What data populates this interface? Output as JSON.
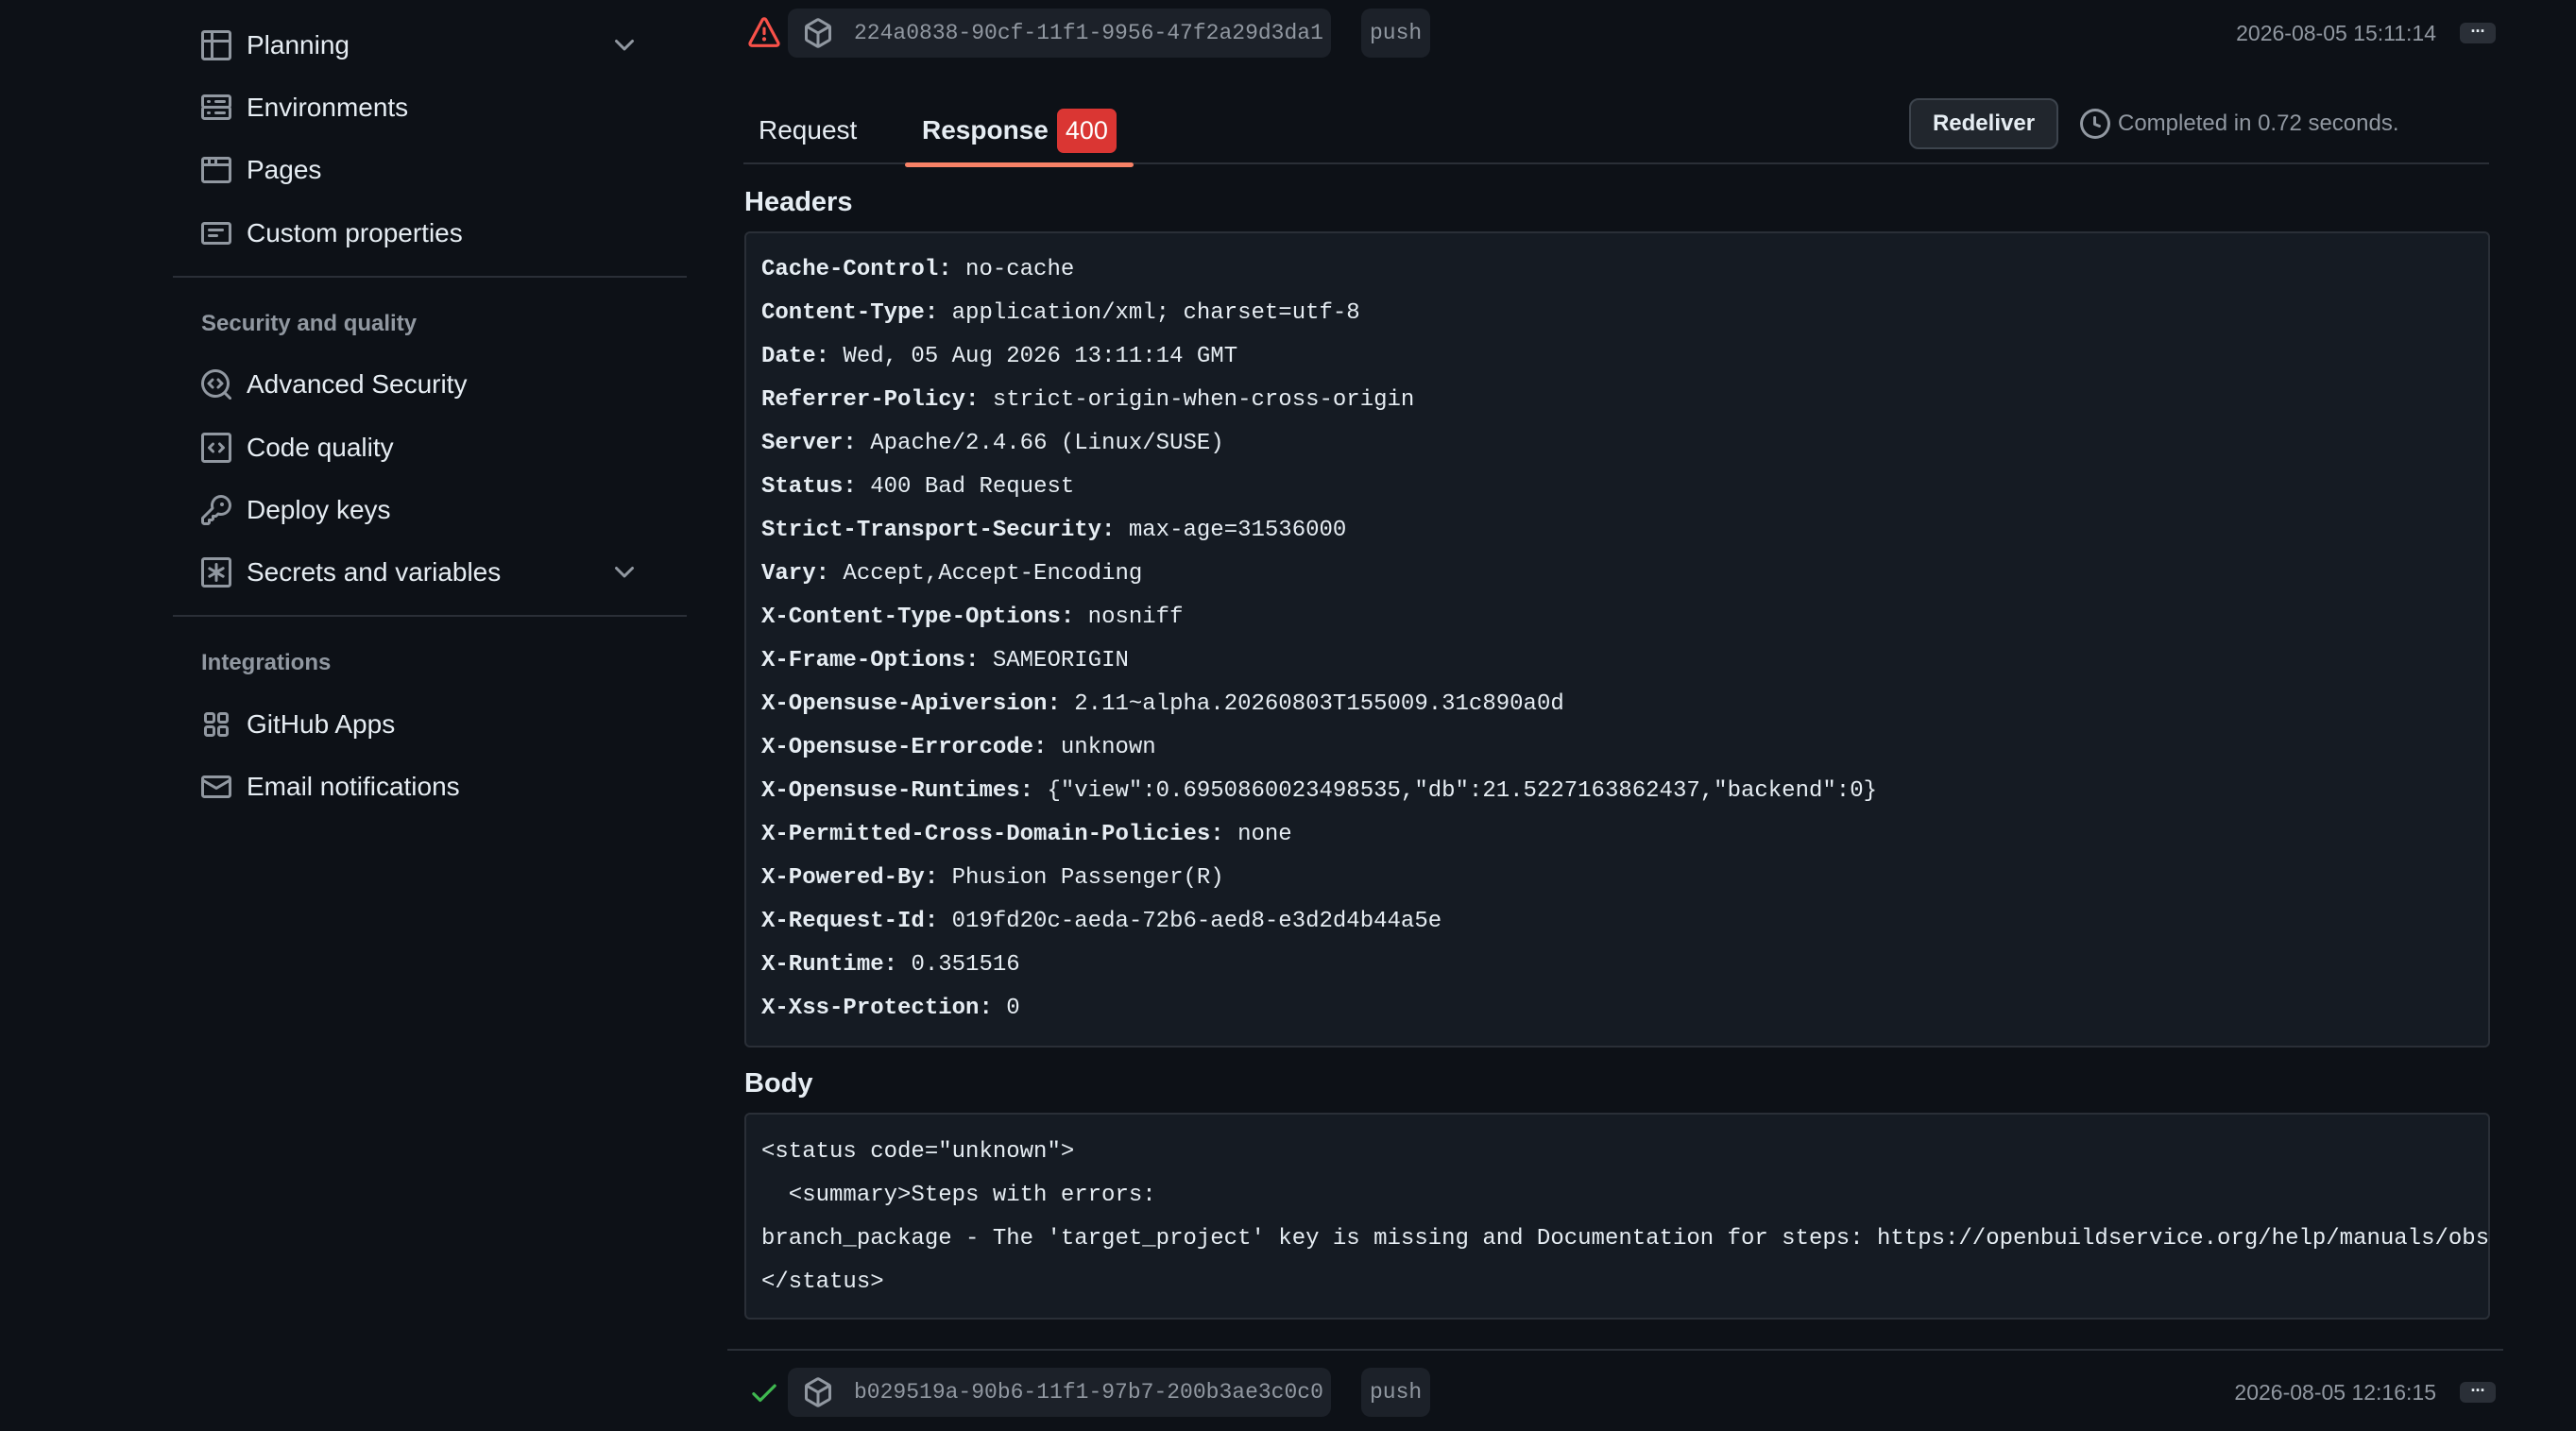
{
  "sidebar": {
    "items_top": [
      {
        "label": "Planning",
        "icon": "table-icon",
        "has_chevron": true
      },
      {
        "label": "Environments",
        "icon": "server-icon",
        "has_chevron": false
      },
      {
        "label": "Pages",
        "icon": "browser-icon",
        "has_chevron": false
      },
      {
        "label": "Custom properties",
        "icon": "note-icon",
        "has_chevron": false
      }
    ],
    "security_section_title": "Security and quality",
    "items_security": [
      {
        "label": "Advanced Security",
        "icon": "codescan-icon",
        "has_chevron": false
      },
      {
        "label": "Code quality",
        "icon": "file-code-icon",
        "has_chevron": false
      },
      {
        "label": "Deploy keys",
        "icon": "key-icon",
        "has_chevron": false
      },
      {
        "label": "Secrets and variables",
        "icon": "asterisk-icon",
        "has_chevron": true
      }
    ],
    "integrations_section_title": "Integrations",
    "items_integrations": [
      {
        "label": "GitHub Apps",
        "icon": "apps-icon",
        "has_chevron": false
      },
      {
        "label": "Email notifications",
        "icon": "mail-icon",
        "has_chevron": false
      }
    ]
  },
  "deliveries": [
    {
      "status": "error",
      "status_icon": "alert-icon",
      "guid": "224a0838-90cf-11f1-9956-47f2a29d3da1",
      "event": "push",
      "timestamp": "2026-08-05 15:11:14",
      "more_label": "..."
    },
    {
      "status": "success",
      "status_icon": "check-icon",
      "guid": "b029519a-90b6-11f1-97b7-200b3ae3c0c0",
      "event": "push",
      "timestamp": "2026-08-05 12:16:15",
      "more_label": "..."
    }
  ],
  "detail": {
    "tabs": {
      "request_label": "Request",
      "response_label": "Response",
      "response_status_code": "400",
      "active": "Response"
    },
    "redeliver_label": "Redeliver",
    "completed_text": "Completed in 0.72 seconds.",
    "headers_title": "Headers",
    "headers": [
      {
        "key": "Cache-Control:",
        "value": "no-cache"
      },
      {
        "key": "Content-Type:",
        "value": "application/xml; charset=utf-8"
      },
      {
        "key": "Date:",
        "value": "Wed, 05 Aug 2026 13:11:14 GMT"
      },
      {
        "key": "Referrer-Policy:",
        "value": "strict-origin-when-cross-origin"
      },
      {
        "key": "Server:",
        "value": "Apache/2.4.66 (Linux/SUSE)"
      },
      {
        "key": "Status:",
        "value": "400 Bad Request"
      },
      {
        "key": "Strict-Transport-Security:",
        "value": "max-age=31536000"
      },
      {
        "key": "Vary:",
        "value": "Accept,Accept-Encoding"
      },
      {
        "key": "X-Content-Type-Options:",
        "value": "nosniff"
      },
      {
        "key": "X-Frame-Options:",
        "value": "SAMEORIGIN"
      },
      {
        "key": "X-Opensuse-Apiversion:",
        "value": "2.11~alpha.20260803T155009.31c890a0d"
      },
      {
        "key": "X-Opensuse-Errorcode:",
        "value": "unknown"
      },
      {
        "key": "X-Opensuse-Runtimes:",
        "value": "{\"view\":0.6950860023498535,\"db\":21.5227163862437,\"backend\":0}"
      },
      {
        "key": "X-Permitted-Cross-Domain-Policies:",
        "value": "none"
      },
      {
        "key": "X-Powered-By:",
        "value": "Phusion Passenger(R)"
      },
      {
        "key": "X-Request-Id:",
        "value": "019fd20c-aeda-72b6-aed8-e3d2d4b44a5e"
      },
      {
        "key": "X-Runtime:",
        "value": "0.351516"
      },
      {
        "key": "X-Xss-Protection:",
        "value": "0"
      }
    ],
    "body_title": "Body",
    "body_lines": [
      "<status code=\"unknown\">",
      "  <summary>Steps with errors:",
      "branch_package - The 'target_project' key is missing and Documentation for steps: https://openbuildservice.org/help/manuals/obs",
      "</status>"
    ]
  }
}
